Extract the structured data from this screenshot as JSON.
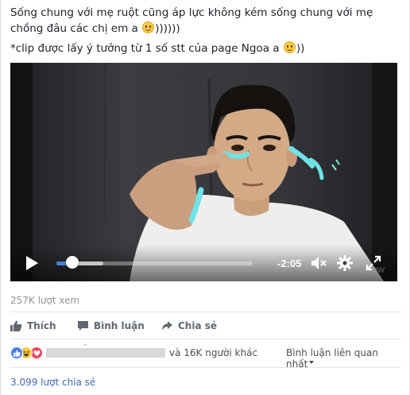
{
  "post": {
    "caption_line1": "Sống chung với mẹ ruột cũng áp lực không kém sống chung với mẹ chồng đâu các chị em a",
    "caption_line1_suffix": "))))))",
    "caption_line2": "*clip được lấy ý tưởng từ 1 số stt của page Ngoa a",
    "caption_line2_suffix": "))"
  },
  "video": {
    "time_remaining": "-2:05",
    "progress_played": 0.08,
    "progress_buffered": 0.24,
    "icons": [
      "play-icon",
      "mute-icon",
      "settings-icon",
      "fullscreen-icon"
    ],
    "accent_color": "#4b7fd6"
  },
  "stats": {
    "views": "257K lượt xem",
    "others": "và 16K người khác",
    "sort_label": "Bình luận liên quan nhất",
    "shares": "3.099 lượt chia sẻ"
  },
  "actions": {
    "like": "Thích",
    "comment": "Bình luận",
    "share": "Chia sẻ"
  },
  "reactions": [
    "like",
    "haha",
    "love"
  ]
}
